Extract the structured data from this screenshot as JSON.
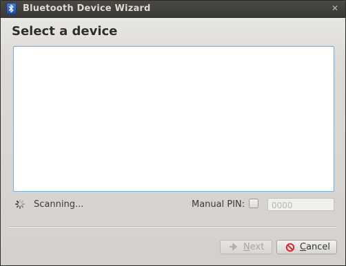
{
  "window": {
    "title": "Bluetooth Device Wizard",
    "app_icon": "bluetooth-icon",
    "close_icon": "close-icon"
  },
  "page": {
    "heading": "Select a device"
  },
  "device_list": {
    "items": []
  },
  "status": {
    "spinner_icon": "spinner-icon",
    "text": "Scanning..."
  },
  "pin": {
    "label": "Manual PIN:",
    "checked": false,
    "placeholder": "0000"
  },
  "buttons": {
    "next_label_mnemonic": "N",
    "next_label_rest": "ext",
    "next_enabled": false,
    "next_icon": "arrow-right-icon",
    "cancel_label_mnemonic": "C",
    "cancel_label_rest": "ancel",
    "cancel_icon": "cancel-icon"
  },
  "colors": {
    "titlebar": "#3c3b37",
    "accent_focus": "#7aaad8",
    "cancel_icon": "#d9262a"
  }
}
